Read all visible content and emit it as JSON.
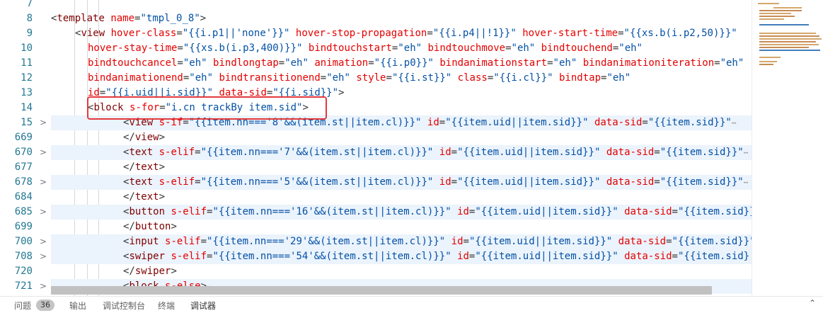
{
  "gutter": {
    "lines": [
      {
        "num": "7",
        "fold": ""
      },
      {
        "num": "8",
        "fold": ""
      },
      {
        "num": "9",
        "fold": ""
      },
      {
        "num": "10",
        "fold": ""
      },
      {
        "num": "11",
        "fold": ""
      },
      {
        "num": "12",
        "fold": ""
      },
      {
        "num": "13",
        "fold": ""
      },
      {
        "num": "14",
        "fold": ""
      },
      {
        "num": "15",
        "fold": ">"
      },
      {
        "num": "669",
        "fold": ""
      },
      {
        "num": "670",
        "fold": ">"
      },
      {
        "num": "677",
        "fold": ""
      },
      {
        "num": "678",
        "fold": ">"
      },
      {
        "num": "684",
        "fold": ""
      },
      {
        "num": "685",
        "fold": ">"
      },
      {
        "num": "699",
        "fold": ""
      },
      {
        "num": "700",
        "fold": ">"
      },
      {
        "num": "708",
        "fold": ">"
      },
      {
        "num": "720",
        "fold": ""
      },
      {
        "num": "721",
        "fold": ">"
      }
    ]
  },
  "code": {
    "lines": [
      {
        "indent": 0,
        "hl": false,
        "tokens": []
      },
      {
        "indent": 0,
        "hl": false,
        "tokens": [
          [
            "punc",
            "<"
          ],
          [
            "tag",
            "template"
          ],
          [
            "punc",
            " "
          ],
          [
            "attr",
            "name"
          ],
          [
            "punc",
            "="
          ],
          [
            "str",
            "\"tmpl_0_8\""
          ],
          [
            "punc",
            ">"
          ]
        ]
      },
      {
        "indent": 1,
        "hl": false,
        "tokens": [
          [
            "punc",
            "<"
          ],
          [
            "tag",
            "view"
          ],
          [
            "punc",
            " "
          ],
          [
            "attr",
            "hover-class"
          ],
          [
            "punc",
            "="
          ],
          [
            "str",
            "\"{{i.p1||'none'}}\""
          ],
          [
            "punc",
            " "
          ],
          [
            "attr",
            "hover-stop-propagation"
          ],
          [
            "punc",
            "="
          ],
          [
            "str",
            "\"{{i.p4||!1}}\""
          ],
          [
            "punc",
            " "
          ],
          [
            "attr",
            "hover-start-time"
          ],
          [
            "punc",
            "="
          ],
          [
            "str",
            "\"{{xs.b(i.p2,50)}}\""
          ]
        ]
      },
      {
        "indent": 2,
        "hl": false,
        "tokens": [
          [
            "attr",
            "hover-stay-time"
          ],
          [
            "punc",
            "="
          ],
          [
            "str",
            "\"{{xs.b(i.p3,400)}}\""
          ],
          [
            "punc",
            " "
          ],
          [
            "attr",
            "bindtouchstart"
          ],
          [
            "punc",
            "="
          ],
          [
            "str",
            "\"eh\""
          ],
          [
            "punc",
            " "
          ],
          [
            "attr",
            "bindtouchmove"
          ],
          [
            "punc",
            "="
          ],
          [
            "str",
            "\"eh\""
          ],
          [
            "punc",
            " "
          ],
          [
            "attr",
            "bindtouchend"
          ],
          [
            "punc",
            "="
          ],
          [
            "str",
            "\"eh\""
          ]
        ]
      },
      {
        "indent": 2,
        "hl": false,
        "tokens": [
          [
            "attr",
            "bindtouchcancel"
          ],
          [
            "punc",
            "="
          ],
          [
            "str",
            "\"eh\""
          ],
          [
            "punc",
            " "
          ],
          [
            "attr",
            "bindlongtap"
          ],
          [
            "punc",
            "="
          ],
          [
            "str",
            "\"eh\""
          ],
          [
            "punc",
            " "
          ],
          [
            "attr",
            "animation"
          ],
          [
            "punc",
            "="
          ],
          [
            "str",
            "\"{{i.p0}}\""
          ],
          [
            "punc",
            " "
          ],
          [
            "attr",
            "bindanimationstart"
          ],
          [
            "punc",
            "="
          ],
          [
            "str",
            "\"eh\""
          ],
          [
            "punc",
            " "
          ],
          [
            "attr",
            "bindanimationiteration"
          ],
          [
            "punc",
            "="
          ],
          [
            "str",
            "\"eh\""
          ]
        ]
      },
      {
        "indent": 2,
        "hl": false,
        "tokens": [
          [
            "attr",
            "bindanimationend"
          ],
          [
            "punc",
            "="
          ],
          [
            "str",
            "\"eh\""
          ],
          [
            "punc",
            " "
          ],
          [
            "attr",
            "bindtransitionend"
          ],
          [
            "punc",
            "="
          ],
          [
            "str",
            "\"eh\""
          ],
          [
            "punc",
            " "
          ],
          [
            "attr",
            "style"
          ],
          [
            "punc",
            "="
          ],
          [
            "str",
            "\"{{i.st}}\""
          ],
          [
            "punc",
            " "
          ],
          [
            "attr",
            "class"
          ],
          [
            "punc",
            "="
          ],
          [
            "str",
            "\"{{i.cl}}\""
          ],
          [
            "punc",
            " "
          ],
          [
            "attr",
            "bindtap"
          ],
          [
            "punc",
            "="
          ],
          [
            "str",
            "\"eh\""
          ]
        ]
      },
      {
        "indent": 2,
        "hl": false,
        "tokens": [
          [
            "attr",
            "id"
          ],
          [
            "punc",
            "="
          ],
          [
            "str",
            "\"{{i.uid||i.sid}}\""
          ],
          [
            "punc",
            " "
          ],
          [
            "attr",
            "data-sid"
          ],
          [
            "punc",
            "="
          ],
          [
            "str",
            "\"{{i.sid}}\""
          ],
          [
            "punc",
            ">"
          ]
        ]
      },
      {
        "indent": 2,
        "hl": false,
        "tokens": [
          [
            "punc",
            "<"
          ],
          [
            "tag",
            "block"
          ],
          [
            "punc",
            " "
          ],
          [
            "attr",
            "s-for"
          ],
          [
            "punc",
            "="
          ],
          [
            "str",
            "\"i.cn trackBy item.sid\""
          ],
          [
            "punc",
            ">"
          ]
        ]
      },
      {
        "indent": 3,
        "hl": true,
        "tokens": [
          [
            "punc",
            "<"
          ],
          [
            "tag",
            "view"
          ],
          [
            "punc",
            " "
          ],
          [
            "attr",
            "s-if"
          ],
          [
            "punc",
            "="
          ],
          [
            "str",
            "\"{{item.nn==='8'&&(item.st||item.cl)}}\""
          ],
          [
            "punc",
            " "
          ],
          [
            "attr",
            "id"
          ],
          [
            "punc",
            "="
          ],
          [
            "str",
            "\"{{item.uid||item.sid}}\""
          ],
          [
            "punc",
            " "
          ],
          [
            "attr",
            "data-sid"
          ],
          [
            "punc",
            "="
          ],
          [
            "str",
            "\"{{item.sid}}\""
          ]
        ],
        "more": "⋯"
      },
      {
        "indent": 3,
        "hl": false,
        "tokens": [
          [
            "punc",
            "</"
          ],
          [
            "tag",
            "view"
          ],
          [
            "punc",
            ">"
          ]
        ]
      },
      {
        "indent": 3,
        "hl": true,
        "tokens": [
          [
            "punc",
            "<"
          ],
          [
            "tag",
            "text"
          ],
          [
            "punc",
            " "
          ],
          [
            "attr",
            "s-elif"
          ],
          [
            "punc",
            "="
          ],
          [
            "str",
            "\"{{item.nn==='7'&&(item.st||item.cl)}}\""
          ],
          [
            "punc",
            " "
          ],
          [
            "attr",
            "id"
          ],
          [
            "punc",
            "="
          ],
          [
            "str",
            "\"{{item.uid||item.sid}}\""
          ],
          [
            "punc",
            " "
          ],
          [
            "attr",
            "data-sid"
          ],
          [
            "punc",
            "="
          ],
          [
            "str",
            "\"{{item.sid}}\""
          ]
        ],
        "more": "⋯"
      },
      {
        "indent": 3,
        "hl": false,
        "tokens": [
          [
            "punc",
            "</"
          ],
          [
            "tag",
            "text"
          ],
          [
            "punc",
            ">"
          ]
        ]
      },
      {
        "indent": 3,
        "hl": true,
        "tokens": [
          [
            "punc",
            "<"
          ],
          [
            "tag",
            "text"
          ],
          [
            "punc",
            " "
          ],
          [
            "attr",
            "s-elif"
          ],
          [
            "punc",
            "="
          ],
          [
            "str",
            "\"{{item.nn==='5'&&(item.st||item.cl)}}\""
          ],
          [
            "punc",
            " "
          ],
          [
            "attr",
            "id"
          ],
          [
            "punc",
            "="
          ],
          [
            "str",
            "\"{{item.uid||item.sid}}\""
          ],
          [
            "punc",
            " "
          ],
          [
            "attr",
            "data-sid"
          ],
          [
            "punc",
            "="
          ],
          [
            "str",
            "\"{{item.sid}}\""
          ]
        ],
        "more": "⋯"
      },
      {
        "indent": 3,
        "hl": false,
        "tokens": [
          [
            "punc",
            "</"
          ],
          [
            "tag",
            "text"
          ],
          [
            "punc",
            ">"
          ]
        ]
      },
      {
        "indent": 3,
        "hl": true,
        "tokens": [
          [
            "punc",
            "<"
          ],
          [
            "tag",
            "button"
          ],
          [
            "punc",
            " "
          ],
          [
            "attr",
            "s-elif"
          ],
          [
            "punc",
            "="
          ],
          [
            "str",
            "\"{{item.nn==='16'&&(item.st||item.cl)}}\""
          ],
          [
            "punc",
            " "
          ],
          [
            "attr",
            "id"
          ],
          [
            "punc",
            "="
          ],
          [
            "str",
            "\"{{item.uid||item.sid}}\""
          ],
          [
            "punc",
            " "
          ],
          [
            "attr",
            "data-sid"
          ],
          [
            "punc",
            "="
          ],
          [
            "str",
            "\"{{item.sid}}"
          ]
        ]
      },
      {
        "indent": 3,
        "hl": false,
        "tokens": [
          [
            "punc",
            "</"
          ],
          [
            "tag",
            "button"
          ],
          [
            "punc",
            ">"
          ]
        ]
      },
      {
        "indent": 3,
        "hl": true,
        "tokens": [
          [
            "punc",
            "<"
          ],
          [
            "tag",
            "input"
          ],
          [
            "punc",
            " "
          ],
          [
            "attr",
            "s-elif"
          ],
          [
            "punc",
            "="
          ],
          [
            "str",
            "\"{{item.nn==='29'&&(item.st||item.cl)}}\""
          ],
          [
            "punc",
            " "
          ],
          [
            "attr",
            "id"
          ],
          [
            "punc",
            "="
          ],
          [
            "str",
            "\"{{item.uid||item.sid}}\""
          ],
          [
            "punc",
            " "
          ],
          [
            "attr",
            "data-sid"
          ],
          [
            "punc",
            "="
          ],
          [
            "str",
            "\"{{item.sid}}\""
          ]
        ]
      },
      {
        "indent": 3,
        "hl": true,
        "tokens": [
          [
            "punc",
            "<"
          ],
          [
            "tag",
            "swiper"
          ],
          [
            "punc",
            " "
          ],
          [
            "attr",
            "s-elif"
          ],
          [
            "punc",
            "="
          ],
          [
            "str",
            "\"{{item.nn==='54'&&(item.st||item.cl)}}\""
          ],
          [
            "punc",
            " "
          ],
          [
            "attr",
            "id"
          ],
          [
            "punc",
            "="
          ],
          [
            "str",
            "\"{{item.uid||item.sid}}\""
          ],
          [
            "punc",
            " "
          ],
          [
            "attr",
            "data-sid"
          ],
          [
            "punc",
            "="
          ],
          [
            "str",
            "\"{{item.sid}"
          ]
        ]
      },
      {
        "indent": 3,
        "hl": false,
        "tokens": [
          [
            "punc",
            "</"
          ],
          [
            "tag",
            "swiper"
          ],
          [
            "punc",
            ">"
          ]
        ]
      },
      {
        "indent": 3,
        "hl": true,
        "tokens": [
          [
            "punc",
            "<"
          ],
          [
            "tag",
            "block"
          ],
          [
            "punc",
            " "
          ],
          [
            "attr",
            "s-else"
          ],
          [
            "punc",
            ">"
          ]
        ],
        "more": "⋯"
      }
    ]
  },
  "panel": {
    "tabs": [
      {
        "label": "问题",
        "active": false
      },
      {
        "label": "输出",
        "active": false
      },
      {
        "label": "调试控制台",
        "active": false
      },
      {
        "label": "终端",
        "active": false
      },
      {
        "label": "调试器",
        "active": true
      }
    ],
    "problems_count": "36"
  },
  "colors": {
    "tag": "#800000",
    "attribute": "#e50000",
    "string": "#0451a5",
    "line_number": "#237893",
    "highlight_box": "#e4393c"
  },
  "icons": {
    "fold_collapsed": "chevron-right-icon",
    "folded_ellipsis": "ellipsis-icon",
    "panel_toggle": "chevron-up-icon"
  }
}
